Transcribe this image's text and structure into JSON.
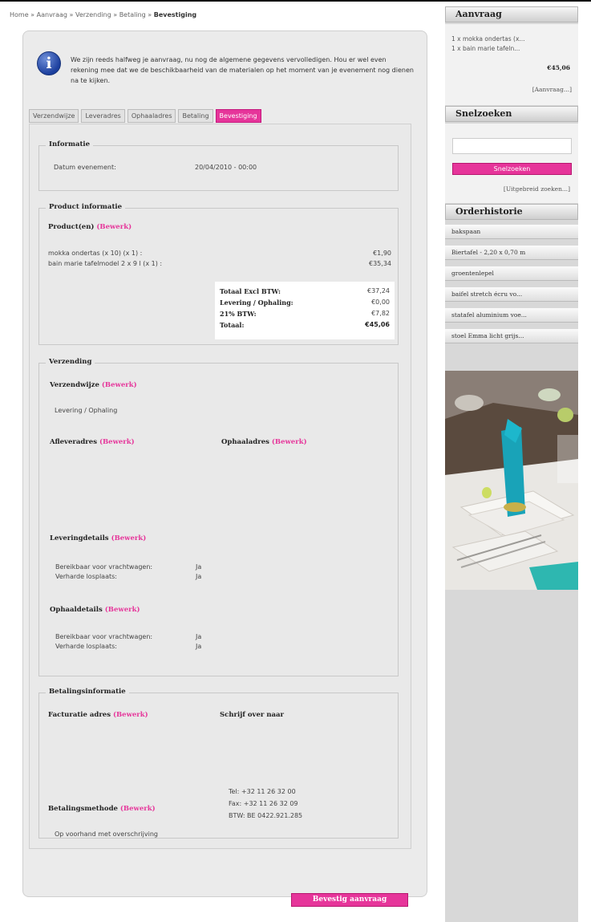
{
  "breadcrumb": {
    "items": [
      "Home",
      "Aanvraag",
      "Verzending",
      "Betaling"
    ],
    "separator": "»",
    "current": "Bevestiging"
  },
  "notice": {
    "icon": "info-icon",
    "text": "We zijn reeds halfweg je aanvraag, nu nog de algemene gegevens vervolledigen. Hou er wel even rekening mee dat we de beschikbaarheid van de materialen op het moment van je evenement nog dienen na te kijken."
  },
  "tabs": [
    {
      "label": "Verzendwijze",
      "active": false
    },
    {
      "label": "Leveradres",
      "active": false
    },
    {
      "label": "Ophaaladres",
      "active": false
    },
    {
      "label": "Betaling",
      "active": false
    },
    {
      "label": "Bevestiging",
      "active": true
    }
  ],
  "edit_label": "(Bewerk)",
  "informatie": {
    "legend": "Informatie",
    "date_label": "Datum evenement:",
    "date_value": "20/04/2010 - 00:00"
  },
  "product": {
    "legend": "Product informatie",
    "heading": "Product(en)",
    "lines": [
      {
        "name": "mokka ondertas (x 10) (x 1) :",
        "price": "€1,90"
      },
      {
        "name": "bain marie tafelmodel 2 x 9 l (x 1) :",
        "price": "€35,34"
      }
    ],
    "totals": [
      {
        "label": "Totaal Excl BTW:",
        "value": "€37,24"
      },
      {
        "label": "Levering / Ophaling:",
        "value": "€0,00"
      },
      {
        "label": "21% BTW:",
        "value": "€7,82"
      },
      {
        "label": "Totaal:",
        "value": "€45,06"
      }
    ]
  },
  "verzending": {
    "legend": "Verzending",
    "method_heading": "Verzendwijze",
    "method_value": "Levering / Ophaling",
    "delivery_address_heading": "Afleveradres",
    "pickup_address_heading": "Ophaaladres",
    "delivery_details_heading": "Leveringdetails",
    "delivery_details": [
      {
        "label": "Bereikbaar voor vrachtwagen:",
        "value": "Ja"
      },
      {
        "label": "Verharde losplaats:",
        "value": "Ja"
      }
    ],
    "pickup_details_heading": "Ophaaldetails",
    "pickup_details": [
      {
        "label": "Bereikbaar voor vrachtwagen:",
        "value": "Ja"
      },
      {
        "label": "Verharde losplaats:",
        "value": "Ja"
      }
    ]
  },
  "betaling": {
    "legend": "Betalingsinformatie",
    "billing_heading": "Facturatie adres",
    "transfer_heading": "Schrijf over naar",
    "contact": [
      "Tel: +32 11 26 32 00",
      "Fax: +32 11 26 32 09",
      "BTW: BE 0422.921.285"
    ],
    "method_heading": "Betalingsmethode",
    "method_value": "Op voorhand met overschrijving"
  },
  "confirm_button": "Bevestig aanvraag",
  "sidebar": {
    "aanvraag": {
      "title": "Aanvraag",
      "items": [
        "1 x mokka ondertas (x...",
        "1 x bain marie tafeln..."
      ],
      "total": "€45,06",
      "link": "[Aanvraag...]"
    },
    "snelzoeken": {
      "title": "Snelzoeken",
      "input_value": "",
      "button": "Snelzoeken",
      "link": "[Uitgebreid zoeken...]"
    },
    "orderhistorie": {
      "title": "Orderhistorie",
      "items": [
        "bakspaan",
        "Biertafel - 2,20 x 0,70 m",
        "groentenlepel",
        "baifel stretch écru vo...",
        "statafel aluminium voe...",
        "stoel Emma licht grijs..."
      ]
    }
  },
  "colors": {
    "accent": "#e6359a",
    "panel": "#ebebeb",
    "sidebar": "#d8d8d8"
  }
}
